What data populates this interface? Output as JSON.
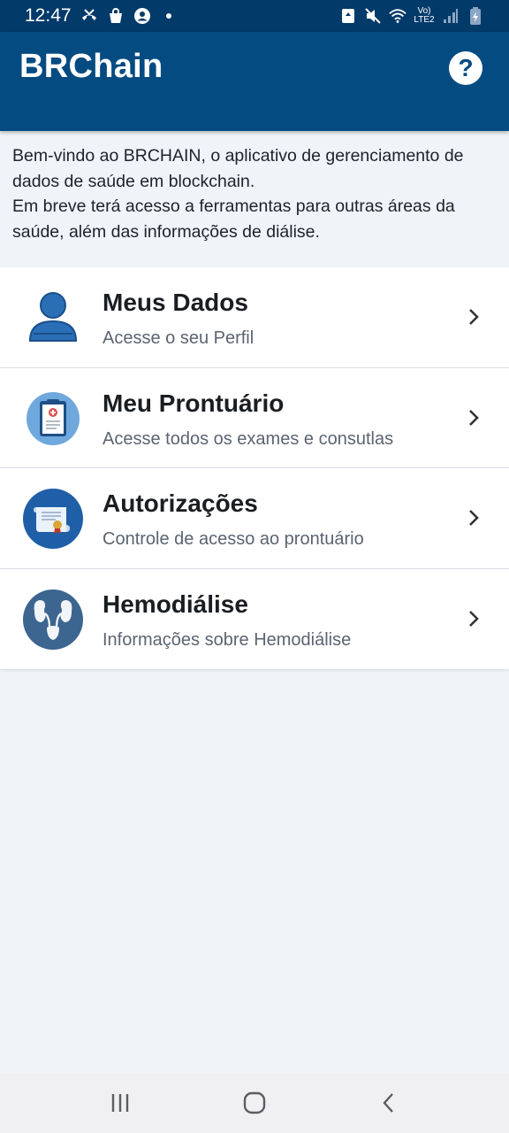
{
  "status_bar": {
    "time": "12:47",
    "icons_left": [
      "missed-call-icon",
      "shopping-bag-icon",
      "account-circle-icon",
      "dot-icon"
    ],
    "icons_right": [
      "sync-icon",
      "mute-icon",
      "wifi-icon",
      "volte-icon",
      "signal-icon",
      "battery-charging-icon"
    ],
    "network_label": "Vo) LTE2"
  },
  "app_bar": {
    "title": "BRChain",
    "help_label": "?"
  },
  "intro": {
    "line1": "Bem-vindo ao BRCHAIN, o aplicativo de gerenciamento de dados de saúde em blockchain.",
    "line2": "Em breve terá acesso a ferramentas para outras áreas da saúde, além das informações de diálise."
  },
  "menu": {
    "items": [
      {
        "title": "Meus Dados",
        "subtitle": "Acesse o seu Perfil",
        "icon": "user-profile-icon"
      },
      {
        "title": "Meu Prontuário",
        "subtitle": "Acesse todos os exames e consutlas",
        "icon": "medical-record-icon"
      },
      {
        "title": "Autorizações",
        "subtitle": "Controle de acesso ao prontuário",
        "icon": "certificate-icon"
      },
      {
        "title": "Hemodiálise",
        "subtitle": "Informações sobre Hemodiálise",
        "icon": "kidneys-icon"
      }
    ]
  },
  "nav_bar": {
    "buttons": [
      "recent-apps-icon",
      "home-icon",
      "back-icon"
    ]
  },
  "colors": {
    "status_bar": "#023a6a",
    "app_bar": "#044b82",
    "background": "#f0f3f8",
    "icon_blue": "#2a6fb6",
    "icon_dark": "#1f4f86"
  }
}
